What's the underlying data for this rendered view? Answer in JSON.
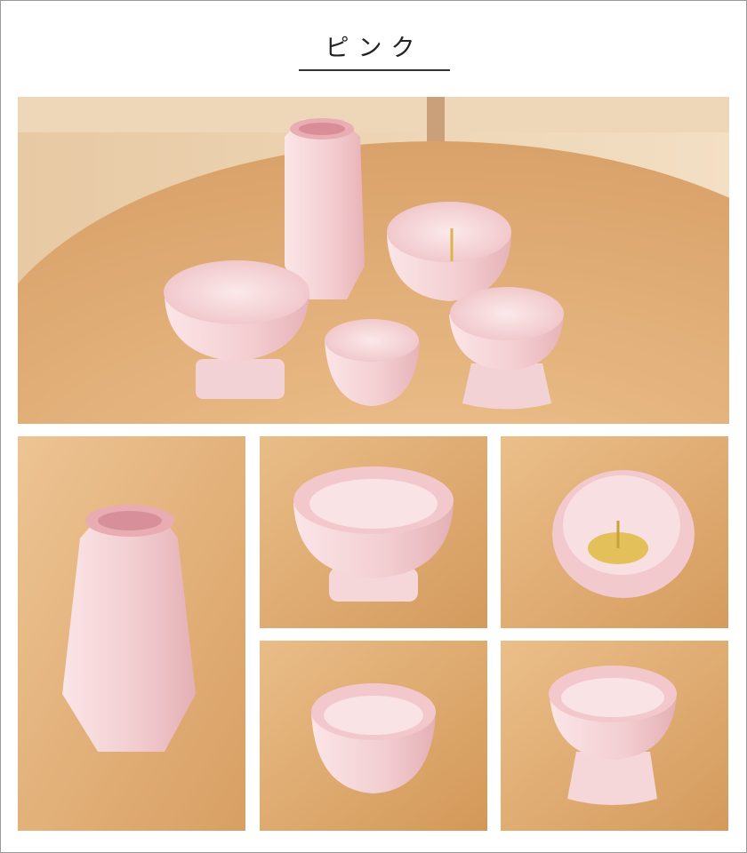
{
  "header": {
    "title": "ピンク"
  },
  "photos": {
    "main": "pink-ceramic-set-photo",
    "vase": "hexagonal-vase-photo",
    "rice_bowl": "footed-bowl-photo",
    "candle_holder": "candle-holder-photo",
    "cup": "small-cup-photo",
    "pedestal_cup": "pedestal-cup-photo"
  },
  "colors": {
    "ceramic_pink": "#f2c9cc",
    "ceramic_light": "#f8dfe1",
    "wood": "#e3b27e",
    "wood_dark": "#c98e56",
    "brass": "#d8b64a"
  }
}
